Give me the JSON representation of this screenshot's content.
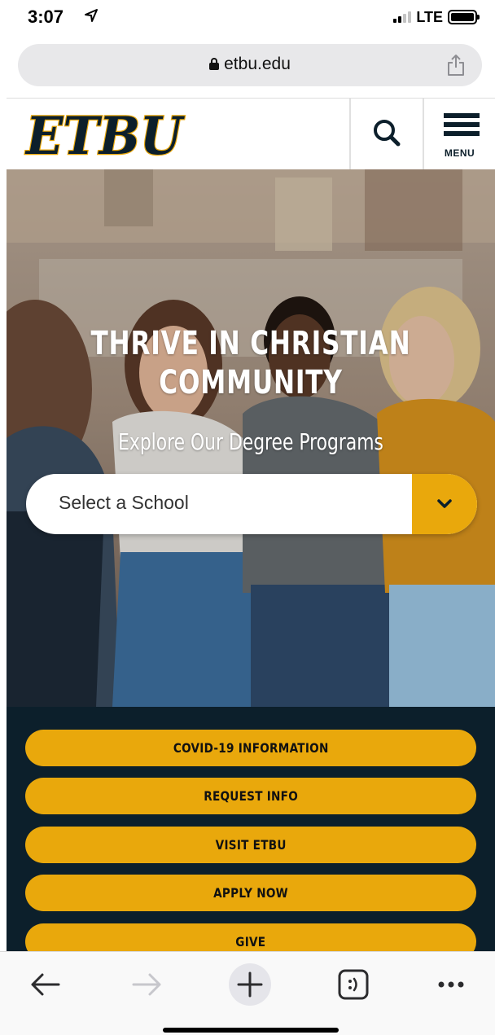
{
  "status_bar": {
    "time": "3:07",
    "network": "LTE"
  },
  "browser": {
    "url": "etbu.edu"
  },
  "site_header": {
    "logo_text": "ETBU",
    "menu_label": "MENU"
  },
  "hero": {
    "headline": "THRIVE IN CHRISTIAN COMMUNITY",
    "subheading": "Explore Our Degree Programs",
    "school_select": {
      "value": "Select a School"
    }
  },
  "actions": [
    {
      "label": "COVID-19 INFORMATION"
    },
    {
      "label": "REQUEST INFO"
    },
    {
      "label": "VISIT ETBU"
    },
    {
      "label": "APPLY NOW"
    },
    {
      "label": "GIVE"
    }
  ],
  "colors": {
    "brand_navy": "#0c1f2b",
    "brand_gold": "#e9a80c"
  }
}
